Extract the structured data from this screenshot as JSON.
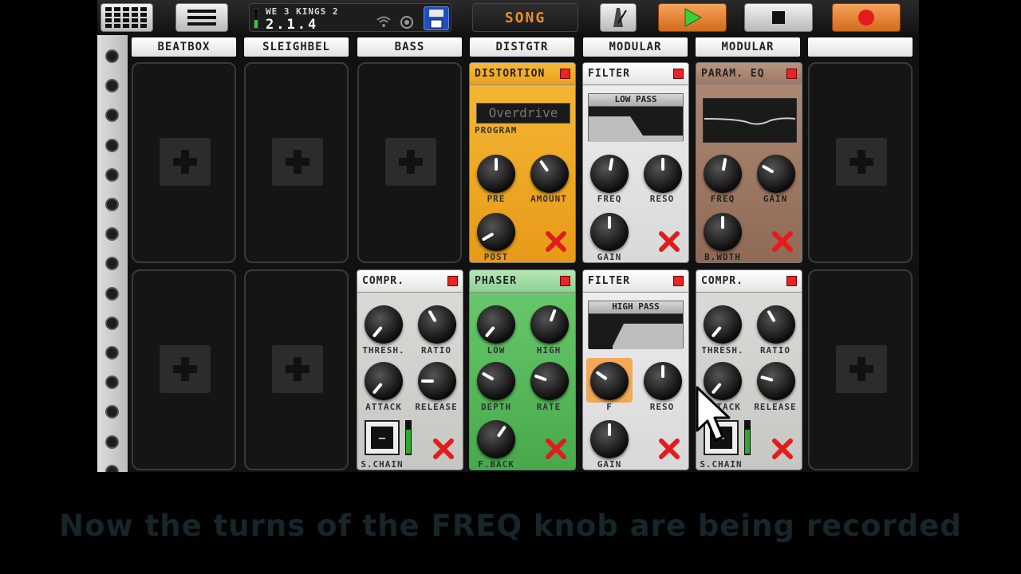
{
  "topbar": {
    "song_title": "WE 3 KINGS 2",
    "version": "2.1.4",
    "song_button": "SONG",
    "input_level": 0.4
  },
  "columns": [
    "BEATBOX",
    "SLEIGHBEL",
    "BASS",
    "DISTGTR",
    "MODULAR",
    "MODULAR",
    ""
  ],
  "effects": {
    "distortion": {
      "title": "DISTORTION",
      "program_value": "Overdrive",
      "program_label": "PROGRAM",
      "knobs": [
        "PRE",
        "AMOUNT",
        "POST"
      ]
    },
    "filter_low": {
      "title": "FILTER",
      "mode": "LOW PASS",
      "knobs": [
        "FREQ",
        "RESO",
        "GAIN"
      ]
    },
    "param_eq": {
      "title": "PARAM. EQ",
      "knobs": [
        "FREQ",
        "GAIN",
        "B.WDTH"
      ]
    },
    "compressor_bass": {
      "title": "COMPR.",
      "knobs": [
        "THRESH.",
        "RATIO",
        "ATTACK",
        "RELEASE"
      ],
      "sidechain": "S.CHAIN"
    },
    "phaser": {
      "title": "PHASER",
      "knobs": [
        "LOW",
        "HIGH",
        "DEPTH",
        "RATE",
        "F.BACK"
      ]
    },
    "filter_high": {
      "title": "FILTER",
      "mode": "HIGH PASS",
      "knobs": [
        "F",
        "RESO",
        "GAIN"
      ]
    },
    "compressor_mod": {
      "title": "COMPR.",
      "knobs": [
        "THRESH.",
        "RATIO",
        "ATTACK",
        "RELEASE"
      ],
      "sidechain": "S.CHAIN"
    }
  },
  "caption": "Now the turns of the FREQ knob are being recorded",
  "colors": {
    "distortion": "#f0a823",
    "filter": "#e6e6e6",
    "param_eq": "#a07a64",
    "compressor": "#d8d8d4",
    "phaser": "#5fbf62",
    "accent_orange": "#e78e2e",
    "led_red": "#e22222"
  },
  "icons": [
    "grid-icon",
    "menu-icon",
    "wifi-icon",
    "settings-icon",
    "save-icon",
    "metronome-icon",
    "play-icon",
    "stop-icon",
    "record-icon",
    "plus-icon",
    "close-icon",
    "cursor-icon"
  ]
}
